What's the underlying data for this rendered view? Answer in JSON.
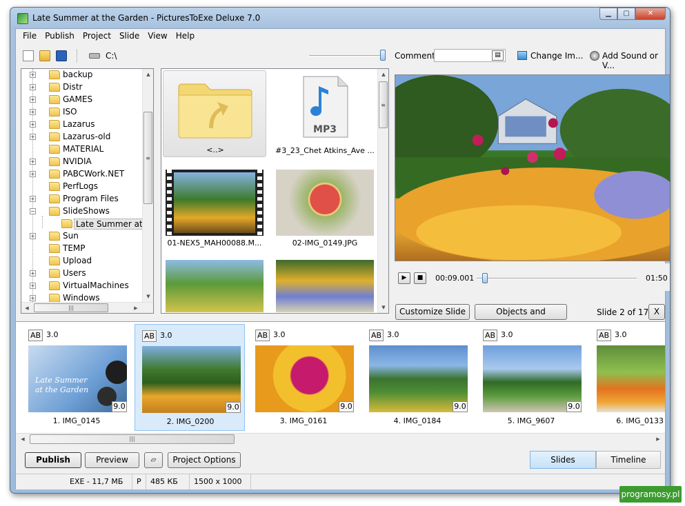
{
  "window": {
    "title": "Late Summer at the Garden - PicturesToExe Deluxe 7.0"
  },
  "menu": [
    "File",
    "Publish",
    "Project",
    "Slide",
    "View",
    "Help"
  ],
  "toolbar": {
    "drive_path": "C:\\",
    "comment_label": "Comment",
    "comment_value": "",
    "change_image_label": "Change Im...",
    "add_sound_label": "Add Sound or V..."
  },
  "tree": {
    "items": [
      {
        "label": "backup"
      },
      {
        "label": "Distr"
      },
      {
        "label": "GAMES"
      },
      {
        "label": "ISO"
      },
      {
        "label": "Lazarus"
      },
      {
        "label": "Lazarus-old"
      },
      {
        "label": "MATERIAL"
      },
      {
        "label": "NVIDIA"
      },
      {
        "label": "PABCWork.NET"
      },
      {
        "label": "PerfLogs"
      },
      {
        "label": "Program Files"
      },
      {
        "label": "SlideShows"
      },
      {
        "label": "Late Summer at th"
      },
      {
        "label": "Sun"
      },
      {
        "label": "TEMP"
      },
      {
        "label": "Upload"
      },
      {
        "label": "Users"
      },
      {
        "label": "VirtualMachines"
      },
      {
        "label": "Windows"
      }
    ]
  },
  "files": {
    "items": [
      {
        "label": "<..>"
      },
      {
        "label": "#3_23_Chet Atkins_Ave ...",
        "badge": "MP3"
      },
      {
        "label": "01-NEX5_MAH00088.M..."
      },
      {
        "label": "02-IMG_0149.JPG"
      }
    ]
  },
  "player": {
    "current_time": "00:09.001",
    "total_time": "01:50",
    "progress": 0.05
  },
  "buttons": {
    "customize_slide": "Customize Slide",
    "objects_animation": "Objects and Animation",
    "close": "X",
    "publish": "Publish",
    "preview": "Preview",
    "project_options": "Project Options"
  },
  "slide_info": "Slide 2 of 17",
  "slides": [
    {
      "ab": "AB",
      "duration": "3.0",
      "end": "9.0",
      "name": "1. IMG_0145",
      "caption": "Late Summer\nat the Garden"
    },
    {
      "ab": "AB",
      "duration": "3.0",
      "end": "9.0",
      "name": "2. IMG_0200"
    },
    {
      "ab": "AB",
      "duration": "3.0",
      "end": "9.0",
      "name": "3. IMG_0161"
    },
    {
      "ab": "AB",
      "duration": "3.0",
      "end": "9.0",
      "name": "4. IMG_0184"
    },
    {
      "ab": "AB",
      "duration": "3.0",
      "end": "9.0",
      "name": "5. IMG_9607"
    },
    {
      "ab": "AB",
      "duration": "3.0",
      "end": "",
      "name": "6. IMG_0133"
    }
  ],
  "tabs": [
    "Slides",
    "Timeline"
  ],
  "status": [
    "EXE - 11,7 МБ",
    "P",
    "485 КБ",
    "1500 x 1000"
  ],
  "watermark": "programosy.pl",
  "colors": {
    "selection": "#d9ebfb",
    "accent": "#7eb4e3"
  }
}
